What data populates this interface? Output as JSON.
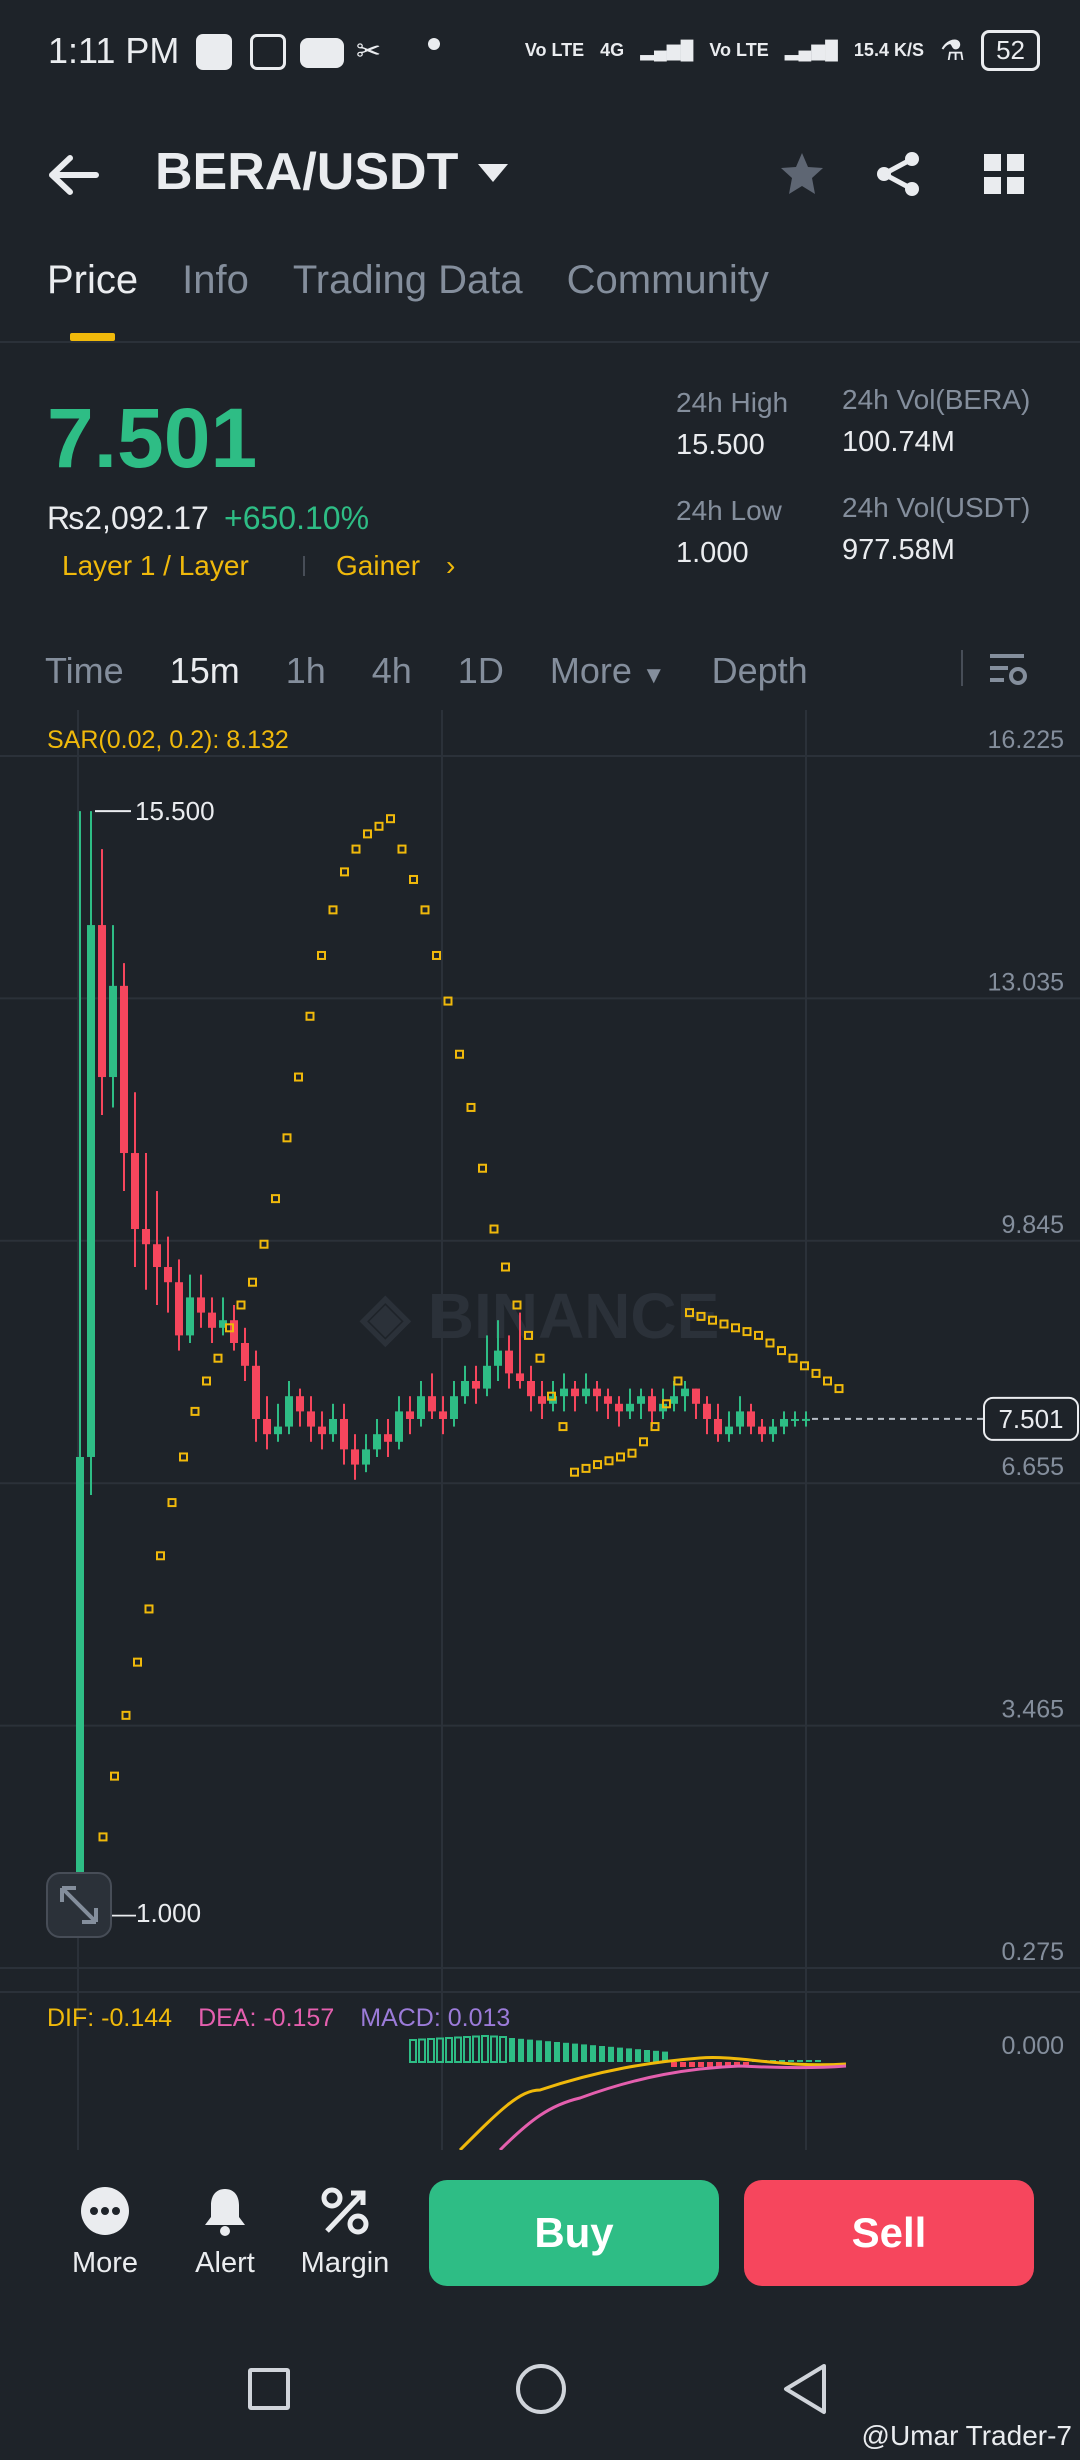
{
  "status_bar": {
    "time": "1:11 PM",
    "network_labels": [
      "Vo LTE",
      "4G",
      "Vo LTE"
    ],
    "speed": "15.4 K/S",
    "battery": "52"
  },
  "header": {
    "pair": "BERA/USDT",
    "icons": [
      "back-arrow-icon",
      "dropdown-caret-icon",
      "star-icon",
      "share-icon",
      "grid-icon"
    ]
  },
  "tabs": [
    {
      "label": "Price",
      "active": true
    },
    {
      "label": "Info",
      "active": false
    },
    {
      "label": "Trading Data",
      "active": false
    },
    {
      "label": "Community",
      "active": false
    }
  ],
  "ticker": {
    "last_price": "7.501",
    "fiat_price": "₨2,092.17",
    "change_pct": "+650.10%",
    "category": "Layer 1 / Layer",
    "tag": "Gainer",
    "high_label": "24h High",
    "high_value": "15.500",
    "low_label": "24h Low",
    "low_value": "1.000",
    "vol_base_label": "24h Vol(BERA)",
    "vol_base_value": "100.74M",
    "vol_quote_label": "24h Vol(USDT)",
    "vol_quote_value": "977.58M"
  },
  "intervals": {
    "items": [
      "Time",
      "15m",
      "1h",
      "4h",
      "1D",
      "More",
      "Depth"
    ],
    "selected": "15m"
  },
  "chart": {
    "sar_label": "SAR(0.02, 0.2): 8.132",
    "watermark": "BINANCE",
    "y_ticks": [
      "16.225",
      "13.035",
      "9.845",
      "6.655",
      "3.465",
      "0.275"
    ],
    "current_price_tag": "7.501",
    "high_marker": "15.500",
    "low_marker": "1.000",
    "macd": {
      "dif": "DIF: -0.144",
      "dea": "DEA: -0.157",
      "macd": "MACD: 0.013",
      "zero_tick": "0.000"
    }
  },
  "chart_data": {
    "type": "candlestick",
    "ylim": [
      0.275,
      16.225
    ],
    "candles": [
      [
        1.0,
        7.0,
        15.5,
        1.0
      ],
      [
        7.0,
        14.0,
        15.5,
        6.5
      ],
      [
        14.0,
        12.0,
        15.0,
        11.5
      ],
      [
        12.0,
        13.2,
        14.0,
        11.6
      ],
      [
        13.2,
        11.0,
        13.5,
        10.5
      ],
      [
        11.0,
        10.0,
        11.8,
        9.5
      ],
      [
        10.0,
        9.8,
        11.0,
        9.2
      ],
      [
        9.8,
        9.5,
        10.5,
        9.0
      ],
      [
        9.5,
        9.3,
        9.9,
        8.9
      ],
      [
        9.3,
        8.6,
        9.6,
        8.4
      ],
      [
        8.6,
        9.1,
        9.4,
        8.5
      ],
      [
        9.1,
        8.9,
        9.4,
        8.7
      ],
      [
        8.9,
        8.7,
        9.1,
        8.5
      ],
      [
        8.7,
        8.8,
        9.1,
        8.6
      ],
      [
        8.8,
        8.5,
        9.0,
        8.4
      ],
      [
        8.5,
        8.2,
        8.7,
        8.0
      ],
      [
        8.2,
        7.5,
        8.4,
        7.2
      ],
      [
        7.5,
        7.3,
        7.8,
        7.1
      ],
      [
        7.3,
        7.4,
        7.7,
        7.2
      ],
      [
        7.4,
        7.8,
        8.0,
        7.3
      ],
      [
        7.8,
        7.6,
        7.9,
        7.4
      ],
      [
        7.6,
        7.4,
        7.8,
        7.2
      ],
      [
        7.4,
        7.3,
        7.6,
        7.1
      ],
      [
        7.3,
        7.5,
        7.7,
        7.2
      ],
      [
        7.5,
        7.1,
        7.7,
        6.9
      ],
      [
        7.1,
        6.9,
        7.3,
        6.7
      ],
      [
        6.9,
        7.1,
        7.3,
        6.8
      ],
      [
        7.1,
        7.3,
        7.5,
        7.0
      ],
      [
        7.3,
        7.2,
        7.5,
        7.0
      ],
      [
        7.2,
        7.6,
        7.8,
        7.1
      ],
      [
        7.6,
        7.5,
        7.8,
        7.3
      ],
      [
        7.5,
        7.8,
        8.0,
        7.4
      ],
      [
        7.8,
        7.6,
        8.1,
        7.5
      ],
      [
        7.6,
        7.5,
        7.8,
        7.3
      ],
      [
        7.5,
        7.8,
        8.0,
        7.4
      ],
      [
        7.8,
        8.0,
        8.2,
        7.7
      ],
      [
        8.0,
        7.9,
        8.2,
        7.7
      ],
      [
        7.9,
        8.2,
        8.6,
        7.8
      ],
      [
        8.2,
        8.4,
        8.8,
        8.0
      ],
      [
        8.4,
        8.1,
        8.6,
        7.9
      ],
      [
        8.1,
        8.0,
        8.9,
        7.9
      ],
      [
        8.0,
        7.8,
        8.2,
        7.6
      ],
      [
        7.8,
        7.7,
        8.0,
        7.5
      ],
      [
        7.7,
        7.8,
        8.0,
        7.6
      ],
      [
        7.8,
        7.9,
        8.1,
        7.6
      ],
      [
        7.9,
        7.8,
        8.0,
        7.6
      ],
      [
        7.8,
        7.9,
        8.1,
        7.7
      ],
      [
        7.9,
        7.8,
        8.0,
        7.6
      ],
      [
        7.8,
        7.7,
        7.9,
        7.5
      ],
      [
        7.7,
        7.6,
        7.8,
        7.4
      ],
      [
        7.6,
        7.7,
        7.9,
        7.5
      ],
      [
        7.7,
        7.8,
        7.9,
        7.5
      ],
      [
        7.8,
        7.6,
        7.9,
        7.4
      ],
      [
        7.6,
        7.7,
        7.9,
        7.5
      ],
      [
        7.7,
        7.8,
        8.0,
        7.6
      ],
      [
        7.8,
        7.9,
        8.0,
        7.6
      ],
      [
        7.9,
        7.7,
        7.9,
        7.5
      ],
      [
        7.7,
        7.5,
        7.8,
        7.3
      ],
      [
        7.5,
        7.3,
        7.7,
        7.2
      ],
      [
        7.3,
        7.4,
        7.6,
        7.2
      ],
      [
        7.4,
        7.6,
        7.8,
        7.3
      ],
      [
        7.6,
        7.4,
        7.7,
        7.3
      ],
      [
        7.4,
        7.3,
        7.5,
        7.2
      ],
      [
        7.3,
        7.4,
        7.5,
        7.2
      ],
      [
        7.4,
        7.5,
        7.6,
        7.3
      ],
      [
        7.5,
        7.5,
        7.6,
        7.4
      ],
      [
        7.5,
        7.501,
        7.6,
        7.4
      ]
    ],
    "sar_points": [
      [
        0,
        1.0
      ],
      [
        1,
        1.0
      ],
      [
        2,
        2.0
      ],
      [
        3,
        2.8
      ],
      [
        4,
        3.6
      ],
      [
        5,
        4.3
      ],
      [
        6,
        5.0
      ],
      [
        7,
        5.7
      ],
      [
        8,
        6.4
      ],
      [
        9,
        7.0
      ],
      [
        10,
        7.6
      ],
      [
        11,
        8.0
      ],
      [
        12,
        8.3
      ],
      [
        13,
        8.7
      ],
      [
        14,
        9.0
      ],
      [
        15,
        9.3
      ],
      [
        16,
        9.8
      ],
      [
        17,
        10.4
      ],
      [
        18,
        11.2
      ],
      [
        19,
        12.0
      ],
      [
        20,
        12.8
      ],
      [
        21,
        13.6
      ],
      [
        22,
        14.2
      ],
      [
        23,
        14.7
      ],
      [
        24,
        15.0
      ],
      [
        25,
        15.2
      ],
      [
        26,
        15.3
      ],
      [
        27,
        15.4
      ],
      [
        28,
        15.0
      ],
      [
        29,
        14.6
      ],
      [
        30,
        14.2
      ],
      [
        31,
        13.6
      ],
      [
        32,
        13.0
      ],
      [
        33,
        12.3
      ],
      [
        34,
        11.6
      ],
      [
        35,
        10.8
      ],
      [
        36,
        10.0
      ],
      [
        37,
        9.5
      ],
      [
        38,
        9.0
      ],
      [
        39,
        8.6
      ],
      [
        40,
        8.3
      ],
      [
        41,
        7.8
      ],
      [
        42,
        7.4
      ],
      [
        43,
        6.8
      ],
      [
        44,
        6.85
      ],
      [
        45,
        6.9
      ],
      [
        46,
        6.95
      ],
      [
        47,
        7.0
      ],
      [
        48,
        7.05
      ],
      [
        49,
        7.2
      ],
      [
        50,
        7.4
      ],
      [
        51,
        7.7
      ],
      [
        52,
        8.0
      ],
      [
        53,
        8.9
      ],
      [
        54,
        8.85
      ],
      [
        55,
        8.8
      ],
      [
        56,
        8.75
      ],
      [
        57,
        8.7
      ],
      [
        58,
        8.65
      ],
      [
        59,
        8.6
      ],
      [
        60,
        8.5
      ],
      [
        61,
        8.4
      ],
      [
        62,
        8.3
      ],
      [
        63,
        8.2
      ],
      [
        64,
        8.1
      ],
      [
        65,
        8.0
      ],
      [
        66,
        7.9
      ]
    ]
  },
  "bottom_actions": {
    "more": "More",
    "alert": "Alert",
    "margin": "Margin",
    "buy": "Buy",
    "sell": "Sell"
  },
  "credit": "@Umar Trader-7",
  "colors": {
    "bg": "#1e2329",
    "up": "#2ebd85",
    "down": "#f6465d",
    "accent": "#f0b90b",
    "muted": "#848e9c",
    "dea": "#e45fae",
    "macd": "#9b7bd8"
  }
}
